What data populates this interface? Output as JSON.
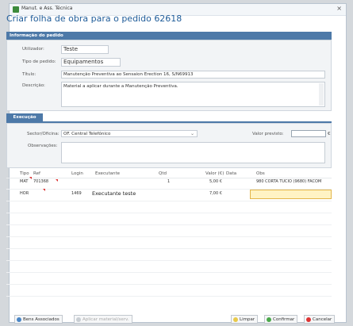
{
  "window": {
    "title": "Manut. e Ass. Técnica",
    "close": "×"
  },
  "heading": "Criar folha de obra para o pedido 62618",
  "info": {
    "section": "Informação do pedido",
    "fields": [
      {
        "label": "Utilizador:",
        "value": "Teste"
      },
      {
        "label": "Tipo de pedido:",
        "value": "Equipamentos"
      },
      {
        "label": "Título:",
        "value": "Manutenção Preventiva ao Sensaion Erection 16, S/N69913"
      },
      {
        "label": "Descrição:",
        "value": "Material a aplicar durante a Manutenção Preventiva."
      }
    ]
  },
  "execucao": {
    "tab": "Execução",
    "sector_label": "Sector/Oficina:",
    "sector_value": "OF. Central Telefónico",
    "valor_label": "Valor previsto:",
    "valor_unit": "€",
    "obs_label": "Observações:"
  },
  "grid": {
    "headers": {
      "tipo": "Tipo",
      "ref": "Ref",
      "login": "Login",
      "executante": "Executante",
      "qtd": "Qtd",
      "valor": "Valor (€)",
      "data": "Data",
      "obs": "Obs"
    },
    "rows": [
      {
        "tipo": "MAT",
        "ref": "701368",
        "login": "",
        "executante": "",
        "qtd": "1",
        "valor": "5,00 €",
        "data": "",
        "obs": "980 CORTA TUCIO (9680) FACOM"
      },
      {
        "tipo": "HOR",
        "ref": "",
        "login": "1469",
        "executante": "Executante teste",
        "qtd": "",
        "valor": "7,00 €",
        "data": "",
        "obs": ""
      }
    ]
  },
  "footer": {
    "bens": "Bens Associados",
    "aplicar": "Aplicar material/serv.",
    "limpar": "Limpar",
    "confirmar": "Confirmar",
    "cancelar": "Cancelar"
  }
}
